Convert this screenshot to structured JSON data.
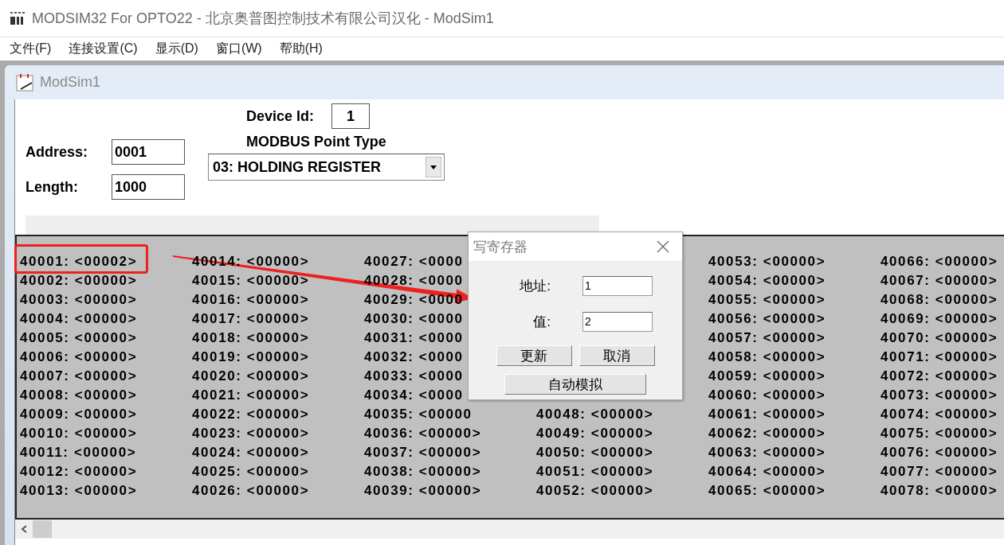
{
  "window": {
    "title": "MODSIM32 For OPTO22 - 北京奥普图控制技术有限公司汉化 - ModSim1"
  },
  "menu": [
    {
      "label": "文件(F)"
    },
    {
      "label": "连接设置(C)"
    },
    {
      "label": "显示(D)"
    },
    {
      "label": "窗口(W)"
    },
    {
      "label": "帮助(H)"
    }
  ],
  "child_window": {
    "title": "ModSim1"
  },
  "form": {
    "device_id": {
      "label": "Device Id:",
      "value": "1"
    },
    "address": {
      "label": "Address:",
      "value": "0001"
    },
    "length": {
      "label": "Length:",
      "value": "1000"
    },
    "point_type": {
      "label": "MODBUS Point Type",
      "value": "03: HOLDING REGISTER"
    }
  },
  "registers": {
    "columns": [
      [
        "40001: <00002>",
        "40002: <00000>",
        "40003: <00000>",
        "40004: <00000>",
        "40005: <00000>",
        "40006: <00000>",
        "40007: <00000>",
        "40008: <00000>",
        "40009: <00000>",
        "40010: <00000>",
        "40011: <00000>",
        "40012: <00000>",
        "40013: <00000>"
      ],
      [
        "40014: <00000>",
        "40015: <00000>",
        "40016: <00000>",
        "40017: <00000>",
        "40018: <00000>",
        "40019: <00000>",
        "40020: <00000>",
        "40021: <00000>",
        "40022: <00000>",
        "40023: <00000>",
        "40024: <00000>",
        "40025: <00000>",
        "40026: <00000>"
      ],
      [
        "40027: <0000",
        "40028: <0000",
        "40029: <0000",
        "40030: <0000",
        "40031: <0000",
        "40032: <0000",
        "40033: <0000",
        "40034: <0000",
        "40035: <00000",
        "40036: <00000>",
        "40037: <00000>",
        "40038: <00000>",
        "40039: <00000>"
      ],
      [
        "40048: <00000>",
        "40049: <00000>",
        "40050: <00000>",
        "40051: <00000>",
        "40052: <00000>"
      ],
      [
        "40053: <00000>",
        "40054: <00000>",
        "40055: <00000>",
        "40056: <00000>",
        "40057: <00000>",
        "40058: <00000>",
        "40059: <00000>",
        "40060: <00000>",
        "40061: <00000>",
        "40062: <00000>",
        "40063: <00000>",
        "40064: <00000>",
        "40065: <00000>"
      ],
      [
        "40066: <00000>",
        "40067: <00000>",
        "40068: <00000>",
        "40069: <00000>",
        "40070: <00000>",
        "40071: <00000>",
        "40072: <00000>",
        "40073: <00000>",
        "40074: <00000>",
        "40075: <00000>",
        "40076: <00000>",
        "40077: <00000>",
        "40078: <00000>"
      ]
    ]
  },
  "dialog": {
    "title": "写寄存器",
    "fields": [
      {
        "label": "地址:",
        "value": "1"
      },
      {
        "label": "值:",
        "value": "2"
      }
    ],
    "buttons": [
      {
        "label": "更新"
      },
      {
        "label": "取消"
      }
    ],
    "wide_button": {
      "label": "自动模拟"
    }
  }
}
